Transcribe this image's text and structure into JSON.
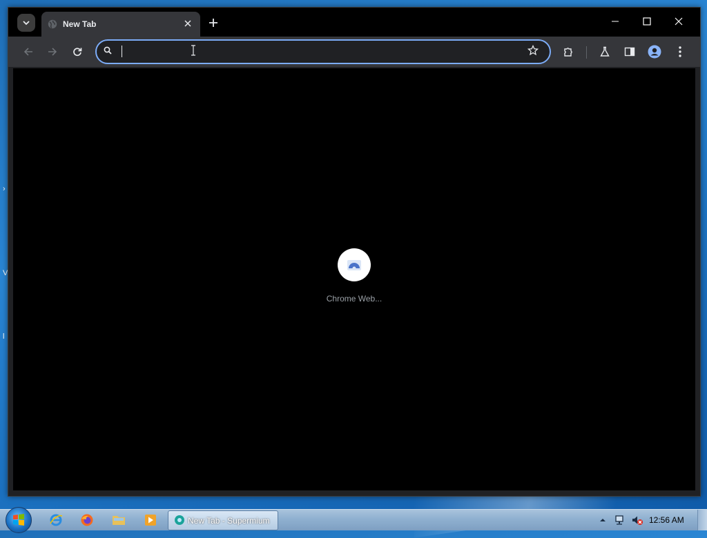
{
  "browser": {
    "tab_title": "New Tab",
    "omnibox_value": "",
    "loading_label": "Chrome Web..."
  },
  "taskbar": {
    "task_button_label": "New Tab - Supermium",
    "clock": "12:56 AM"
  },
  "icons": {
    "tab_search": "chevron-down-icon",
    "favicon": "globe-icon",
    "tab_close": "close-icon",
    "new_tab": "plus-icon",
    "back": "arrow-left-icon",
    "forward": "arrow-right-icon",
    "reload": "reload-icon",
    "omnibox_search": "search-icon",
    "bookmark": "star-icon",
    "extensions": "puzzle-icon",
    "labs": "flask-icon",
    "side_panel": "side-panel-icon",
    "profile": "profile-icon",
    "menu": "more-vert-icon"
  },
  "colors": {
    "accent": "#7cacf8",
    "tab_bg": "#35363a",
    "content_bg": "#000000"
  }
}
